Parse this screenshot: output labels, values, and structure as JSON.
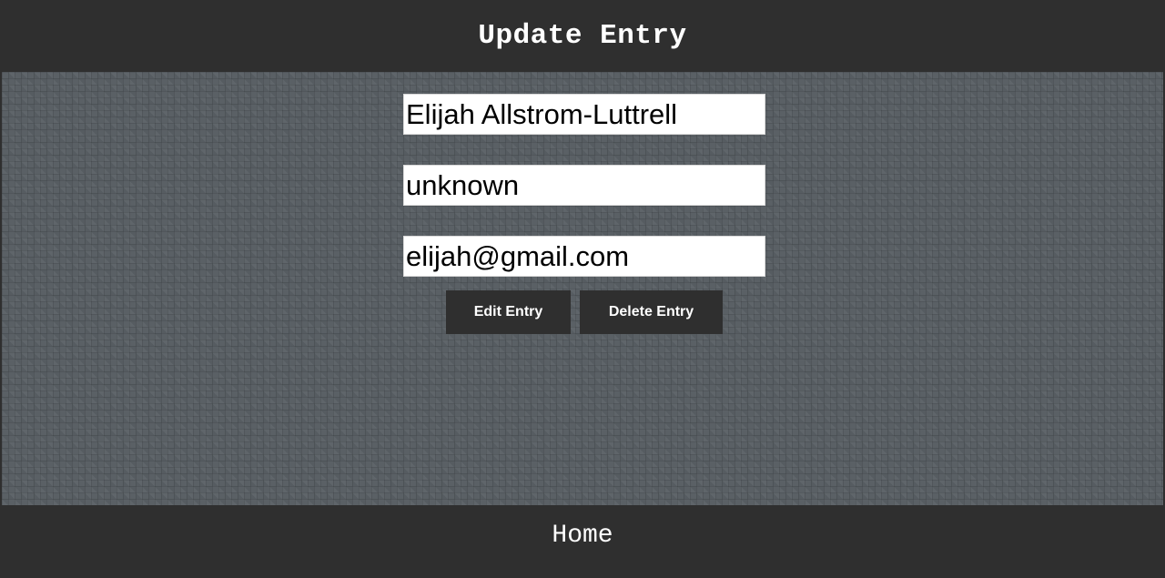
{
  "header": {
    "title": "Update Entry"
  },
  "form": {
    "name_value": "Elijah Allstrom-Luttrell",
    "phone_value": "unknown",
    "email_value": "elijah@gmail.com"
  },
  "actions": {
    "edit_label": "Edit Entry",
    "delete_label": "Delete Entry"
  },
  "footer": {
    "home_label": "Home"
  },
  "colors": {
    "bar_background": "#2f2f2f",
    "main_background": "#5a6065",
    "input_background": "#ffffff",
    "text_light": "#ffffff"
  }
}
